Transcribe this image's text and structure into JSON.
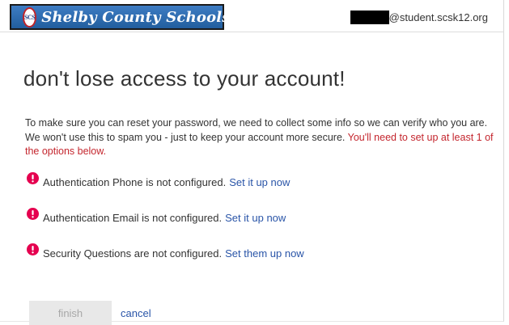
{
  "header": {
    "org_name": "Shelby County Schools",
    "logo_initials": "SCS",
    "user_email_suffix": "@student.scsk12.org"
  },
  "main": {
    "title": "don't lose access to your account!",
    "intro_text": "To make sure you can reset your password, we need to collect some info so we can verify who you are. We won't use this to spam you - just to keep your account more secure. ",
    "intro_warning": "You'll need to set up at least 1 of the options below.",
    "items": [
      {
        "icon": "alert-icon",
        "text": "Authentication Phone is not configured.",
        "link": "Set it up now"
      },
      {
        "icon": "alert-icon",
        "text": "Authentication Email is not configured.",
        "link": "Set it up now"
      },
      {
        "icon": "alert-icon",
        "text": "Security Questions are not configured.",
        "link": "Set them up now"
      }
    ]
  },
  "actions": {
    "finish_label": "finish",
    "cancel_label": "cancel"
  },
  "colors": {
    "link": "#2a55a8",
    "warning": "#c4262e",
    "alert_icon": "#e5004f",
    "header_brand": "#225e9e"
  }
}
